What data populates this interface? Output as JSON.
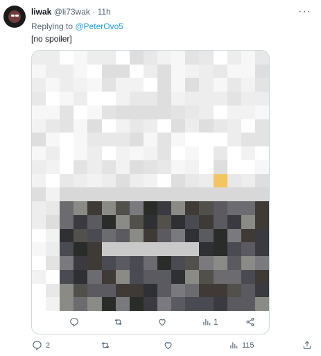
{
  "tweet": {
    "author_name": "liwak",
    "author_handle": "@li73wak",
    "separator": "·",
    "timestamp": "11h",
    "reply_prefix": "Replying to ",
    "reply_mention": "@PeterOvo5",
    "text": "[no spoiler]",
    "more_icon": "more-horizontal-icon"
  },
  "quote_card": {
    "media": "pixelated-redacted-image",
    "actions": {
      "reply_count": "",
      "retweet_count": "",
      "like_count": "",
      "views_count": "1"
    }
  },
  "actions": {
    "reply_count": "2",
    "retweet_count": "",
    "like_count": "",
    "views_count": "115"
  },
  "colors": {
    "text_primary": "#0f1419",
    "text_secondary": "#536471",
    "link": "#1d9bf0",
    "border": "#cfd9de"
  }
}
